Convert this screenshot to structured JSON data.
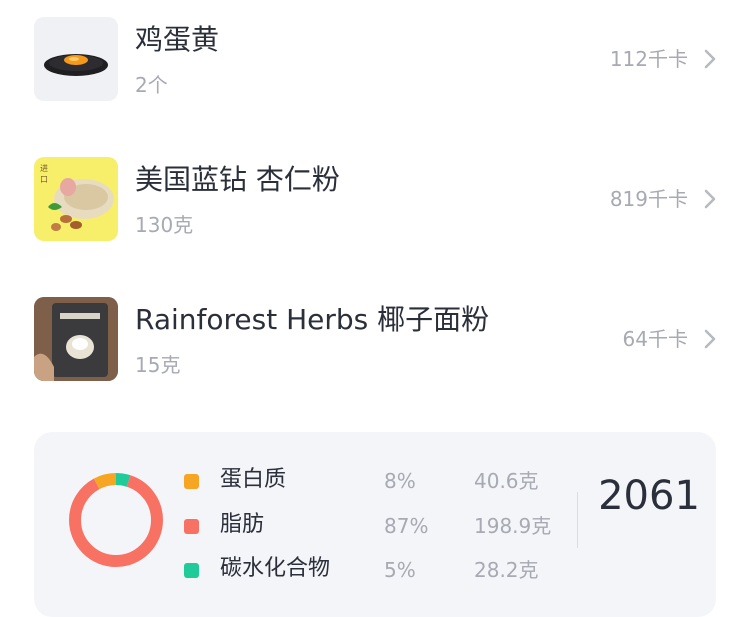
{
  "food_list": [
    {
      "name": "鸡蛋黄",
      "quantity": "2个",
      "calories": "112千卡",
      "thumb_icon": "egg-yolk-photo"
    },
    {
      "name": "美国蓝钻 杏仁粉",
      "quantity": "130克",
      "calories": "819千卡",
      "thumb_icon": "almond-flour-photo"
    },
    {
      "name": "Rainforest Herbs 椰子面粉",
      "quantity": "15克",
      "calories": "64千卡",
      "thumb_icon": "coconut-flour-photo"
    }
  ],
  "summary": {
    "macros": [
      {
        "name": "蛋白质",
        "percent": "8%",
        "grams": "40.6克",
        "color": "#f6a623",
        "fraction": 0.08
      },
      {
        "name": "脂肪",
        "percent": "87%",
        "grams": "198.9克",
        "color": "#f87264",
        "fraction": 0.87
      },
      {
        "name": "碳水化合物",
        "percent": "5%",
        "grams": "28.2克",
        "color": "#1fcc99",
        "fraction": 0.05
      }
    ],
    "total_calories": "2061"
  },
  "colors": {
    "text_primary": "#2b2f3a",
    "text_secondary": "#a7a9b3",
    "card_bg": "#f4f5f9"
  }
}
